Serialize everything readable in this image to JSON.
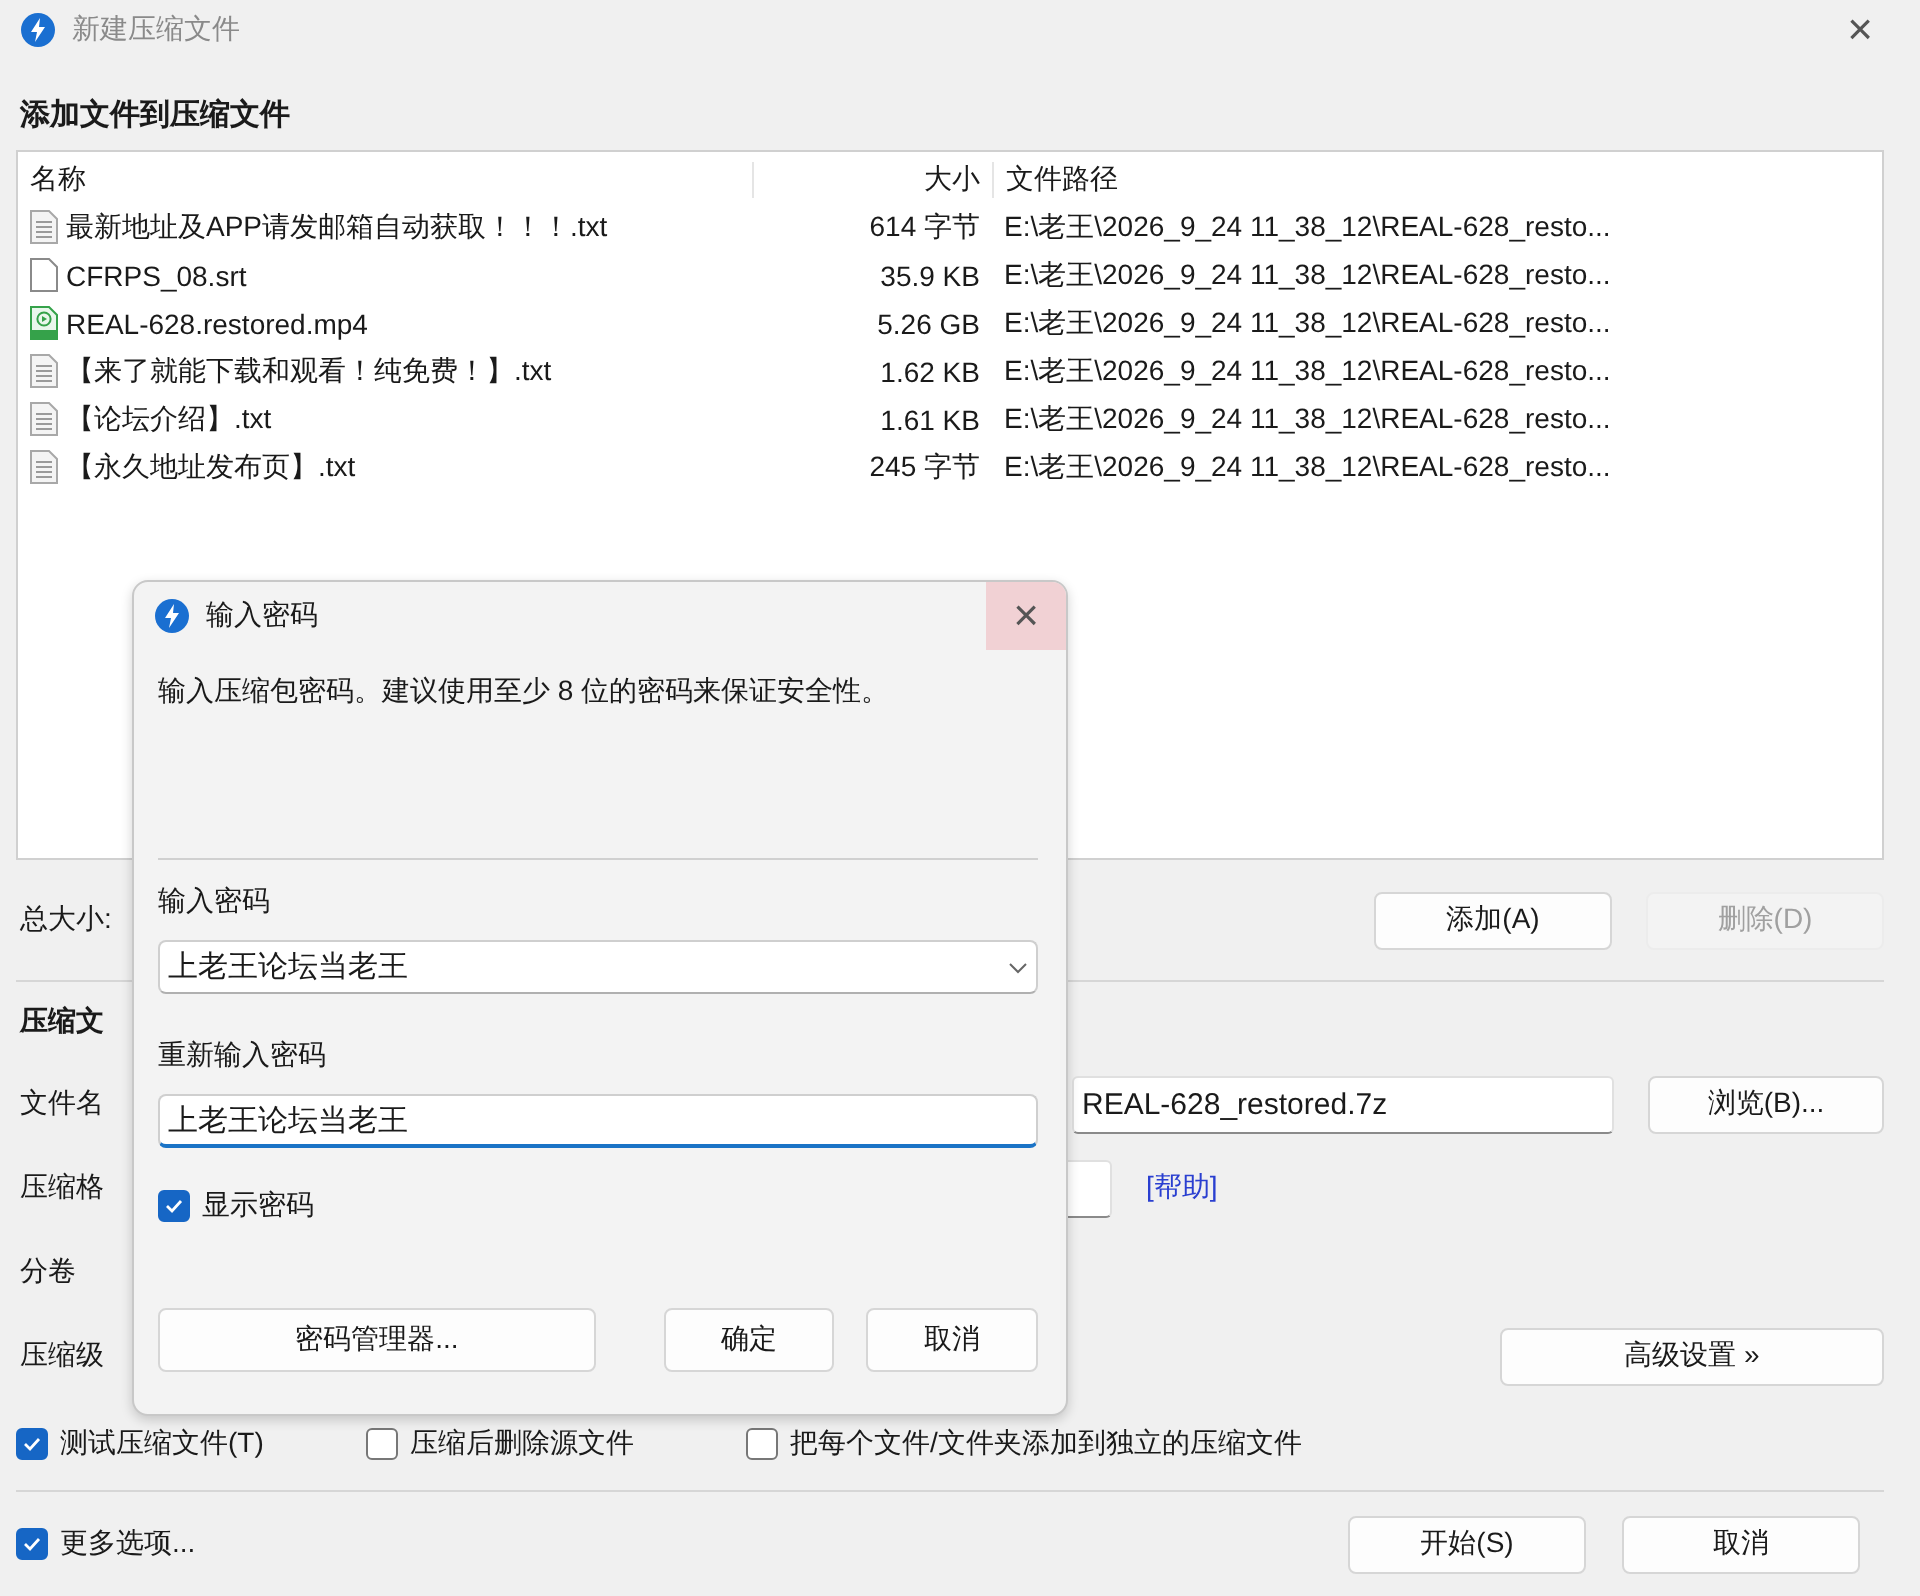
{
  "window": {
    "title": "新建压缩文件",
    "close": "×"
  },
  "heading": "添加文件到压缩文件",
  "file_list": {
    "columns": [
      "名称",
      "大小",
      "文件路径"
    ],
    "rows": [
      {
        "kind": "text",
        "name": "最新地址及APP请发邮箱自动获取！！！.txt",
        "size": "614 字节",
        "path": "E:\\老王\\2026_9_24 11_38_12\\REAL-628_resto..."
      },
      {
        "kind": "blank",
        "name": "CFRPS_08.srt",
        "size": "35.9 KB",
        "path": "E:\\老王\\2026_9_24 11_38_12\\REAL-628_resto..."
      },
      {
        "kind": "video",
        "name": "REAL-628.restored.mp4",
        "size": "5.26 GB",
        "path": "E:\\老王\\2026_9_24 11_38_12\\REAL-628_resto..."
      },
      {
        "kind": "text",
        "name": "【来了就能下载和观看！纯免费！】.txt",
        "size": "1.62 KB",
        "path": "E:\\老王\\2026_9_24 11_38_12\\REAL-628_resto..."
      },
      {
        "kind": "text",
        "name": "【论坛介绍】.txt",
        "size": "1.61 KB",
        "path": "E:\\老王\\2026_9_24 11_38_12\\REAL-628_resto..."
      },
      {
        "kind": "text",
        "name": "【永久地址发布页】.txt",
        "size": "245 字节",
        "path": "E:\\老王\\2026_9_24 11_38_12\\REAL-628_resto..."
      }
    ]
  },
  "total_label": "总大小:",
  "list_buttons": [
    {
      "label": "添加(A)",
      "disabled": false
    },
    {
      "label": "删除(D)",
      "disabled": true
    }
  ],
  "archive_heading": "压缩文",
  "filename": {
    "label": "文件名",
    "value": "REAL-628_restored.7z",
    "browse": "浏览(B)..."
  },
  "format": {
    "label": "压缩格",
    "help": "[帮助]"
  },
  "volume": {
    "label": "分卷"
  },
  "level": {
    "label": "压缩级",
    "advanced": "高级设置 »"
  },
  "options": [
    {
      "label": "测试压缩文件(T)",
      "checked": true
    },
    {
      "label": "压缩后删除源文件",
      "checked": false
    },
    {
      "label": "把每个文件/文件夹添加到独立的压缩文件",
      "checked": false
    }
  ],
  "more_options": {
    "label": "更多选项...",
    "checked": true
  },
  "footer_buttons": [
    "开始(S)",
    "取消"
  ],
  "dialog": {
    "title": "输入密码",
    "close": "×",
    "message": "输入压缩包密码。建议使用至少 8 位的密码来保证安全性。",
    "password_label": "输入密码",
    "password_value": "上老王论坛当老王",
    "repeat_label": "重新输入密码",
    "repeat_value": "上老王论坛当老王",
    "show_password": {
      "label": "显示密码",
      "checked": true
    },
    "buttons": [
      "密码管理器...",
      "确定",
      "取消"
    ]
  }
}
